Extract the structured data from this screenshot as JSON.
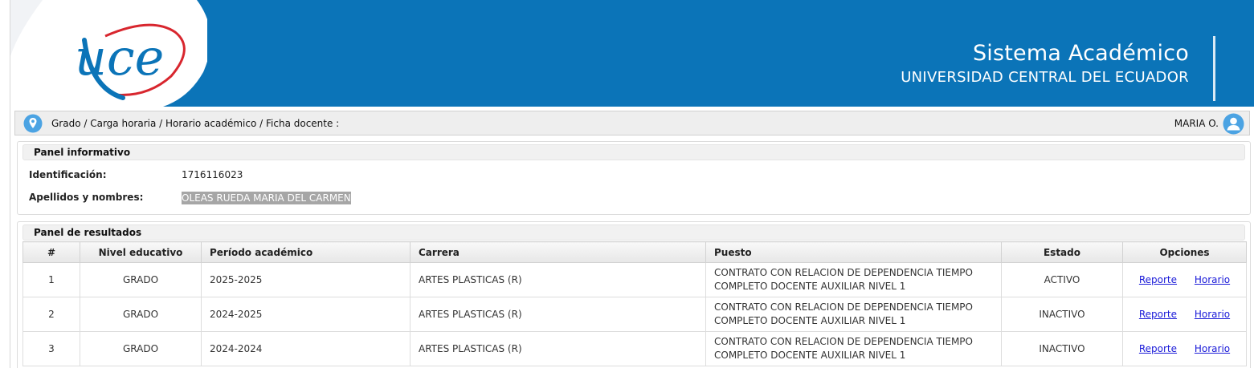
{
  "header": {
    "title": "Sistema Académico",
    "subtitle": "UNIVERSIDAD CENTRAL DEL ECUADOR",
    "logo_text": "uce",
    "colors": {
      "brand_blue": "#0b74b8",
      "logo_red": "#d8262e"
    }
  },
  "breadcrumb": {
    "path": "Grado / Carga horaria / Horario académico / Ficha docente :",
    "user": "MARIA O.",
    "icons": [
      "location-pin-icon",
      "user-avatar-icon"
    ]
  },
  "info_panel": {
    "title": "Panel informativo",
    "id_label": "Identificación:",
    "id_value": "1716116023",
    "name_label": "Apellidos y nombres:",
    "name_value": "OLEAS RUEDA MARIA DEL CARMEN"
  },
  "results_panel": {
    "title": "Panel de resultados",
    "columns": [
      "#",
      "Nivel educativo",
      "Período académico",
      "Carrera",
      "Puesto",
      "Estado",
      "Opciones"
    ],
    "rows": [
      {
        "num": "1",
        "nivel": "GRADO",
        "periodo": "2025-2025",
        "carrera": "ARTES PLASTICAS (R)",
        "puesto_1": "CONTRATO CON RELACION DE DEPENDENCIA TIEMPO",
        "puesto_2": "COMPLETO DOCENTE AUXILIAR NIVEL 1",
        "estado": "ACTIVO",
        "reporte": "Reporte",
        "horario": "Horario"
      },
      {
        "num": "2",
        "nivel": "GRADO",
        "periodo": "2024-2025",
        "carrera": "ARTES PLASTICAS (R)",
        "puesto_1": "CONTRATO CON RELACION DE DEPENDENCIA TIEMPO",
        "puesto_2": "COMPLETO DOCENTE AUXILIAR NIVEL 1",
        "estado": "INACTIVO",
        "reporte": "Reporte",
        "horario": "Horario"
      },
      {
        "num": "3",
        "nivel": "GRADO",
        "periodo": "2024-2024",
        "carrera": "ARTES PLASTICAS (R)",
        "puesto_1": "CONTRATO CON RELACION DE DEPENDENCIA TIEMPO",
        "puesto_2": "COMPLETO DOCENTE AUXILIAR NIVEL 1",
        "estado": "INACTIVO",
        "reporte": "Reporte",
        "horario": "Horario"
      }
    ]
  }
}
